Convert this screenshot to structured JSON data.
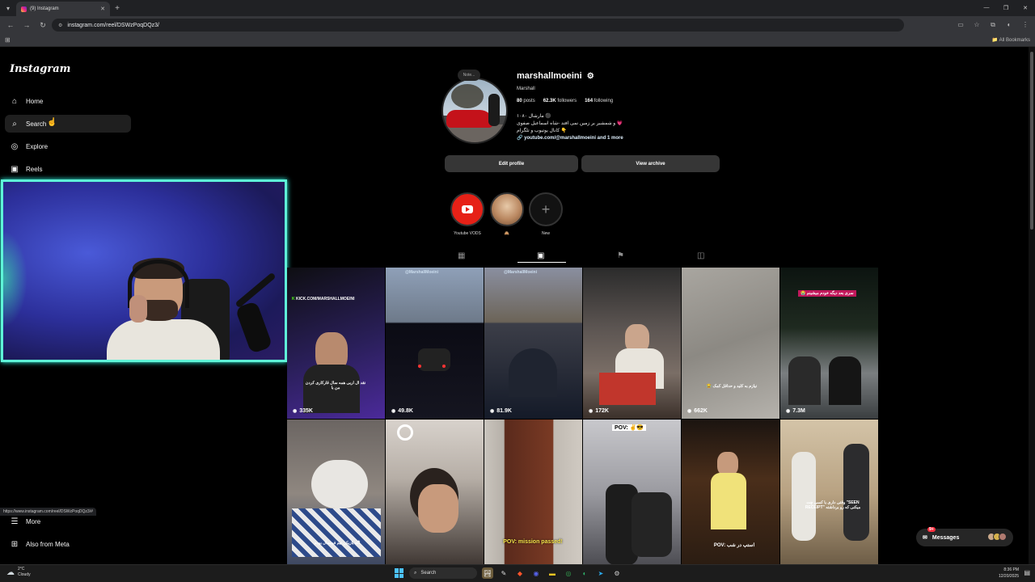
{
  "browser": {
    "tab_title": "(9) Instagram",
    "url": "instagram.com/reel/DSWzPoqDQz3/",
    "all_bookmarks": "All Bookmarks",
    "status_url": "https://www.instagram.com/reel/DSWzPoqDQz3/#"
  },
  "sidebar": {
    "logo": "Instagram",
    "items": [
      {
        "label": "Home",
        "icon": "home-icon"
      },
      {
        "label": "Search",
        "icon": "search-icon"
      },
      {
        "label": "Explore",
        "icon": "explore-icon"
      },
      {
        "label": "Reels",
        "icon": "reels-icon"
      }
    ],
    "bottom": [
      {
        "label": "More",
        "icon": "menu-icon"
      },
      {
        "label": "Also from Meta",
        "icon": "meta-icon"
      }
    ]
  },
  "profile": {
    "note": "Note...",
    "username": "marshallmoeini",
    "fullname": "Marshall",
    "posts_count": "80",
    "posts_label": "posts",
    "followers_count": "62.3K",
    "followers_label": "followers",
    "following_count": "164",
    "following_label": "following",
    "bio_line1": "۱۰۸۰ مارشال ⚫",
    "bio_line2": "و شمشیر بر زمین نمی افتد -شاه اسماعیل صفوی 💗",
    "bio_line3": "کانال یوتیوب و تلگرام 👇",
    "bio_link": "youtube.com/@marshallmoeini and 1 more",
    "edit_profile": "Edit profile",
    "view_archive": "View archive"
  },
  "highlights": [
    {
      "label": "Youtube VODS"
    },
    {
      "label": "🙈"
    },
    {
      "label": "New"
    }
  ],
  "tabs": [
    "posts-tab",
    "reels-tab",
    "saved-tab",
    "tagged-tab"
  ],
  "grid": [
    {
      "views": "335K",
      "caption": "KICK.COM/MARSHALLMOEINI",
      "caption2": "نقد ال اربی همه سال قارکاری کردن من با"
    },
    {
      "views": "49.8K",
      "caption": "@MarshallMoeini"
    },
    {
      "views": "81.9K",
      "caption": "@MarshallMoeini"
    },
    {
      "views": "172K",
      "caption": ""
    },
    {
      "views": "662K",
      "caption": "😂 نیازم به کلید و حداقل کمک"
    },
    {
      "views": "7.3M",
      "caption": "😭 سری بعد دیگه خودم میشینم"
    },
    {
      "views": "",
      "caption": "اگه بازیکن تیم فوتسال بودم"
    },
    {
      "views": "",
      "caption": ""
    },
    {
      "views": "",
      "caption": "POV: mission passed!"
    },
    {
      "views": "",
      "caption": "POV: ✌️😎"
    },
    {
      "views": "",
      "caption": "POV: استپ در شب"
    },
    {
      "views": "",
      "caption": "وقتی داری با کسی چت \"SEEN RECEIPT\" میکنی که رو برداشته"
    }
  ],
  "messages": {
    "label": "Messages",
    "badge": "9+"
  },
  "taskbar": {
    "temp": "2°C",
    "weather": "Cloudy",
    "search": "Search",
    "time": "8:36 PM",
    "date": "12/20/2025"
  }
}
